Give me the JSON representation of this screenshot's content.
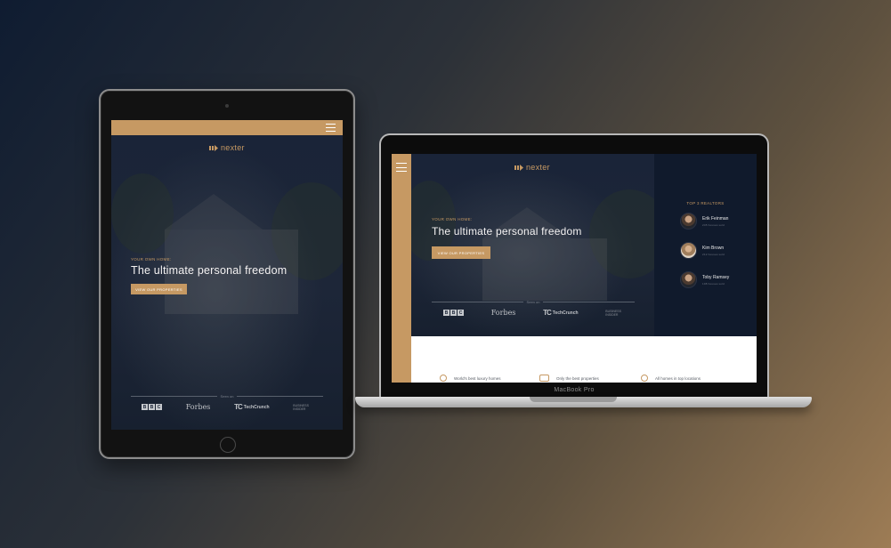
{
  "site": {
    "brand": "nexter",
    "eyebrow": "Your own home:",
    "headline": "The ultimate personal freedom",
    "cta_label": "View our properties",
    "seen_on": "Seen on",
    "press": {
      "bbc": [
        "B",
        "B",
        "C"
      ],
      "forbes": "Forbes",
      "techcrunch_mark": "TC",
      "techcrunch": "TechCrunch",
      "business_insider": [
        "Business",
        "Insider"
      ]
    }
  },
  "realtors": {
    "title": "Top 3 Realtors",
    "items": [
      {
        "name": "Erik Feinman",
        "sub": "245 houses sold"
      },
      {
        "name": "Kim Brown",
        "sub": "212 houses sold"
      },
      {
        "name": "Toby Ramsey",
        "sub": "198 houses sold"
      }
    ]
  },
  "features": [
    {
      "label": "World's best luxury homes",
      "icon": "globe-icon"
    },
    {
      "label": "Only the best properties",
      "icon": "trophy-icon"
    },
    {
      "label": "All homes in top locations",
      "icon": "map-pin-icon"
    }
  ],
  "device": {
    "laptop_model": "MacBook Pro"
  },
  "colors": {
    "accent": "#c69963",
    "dark": "#172033",
    "realtor_panel": "#101a2c"
  }
}
